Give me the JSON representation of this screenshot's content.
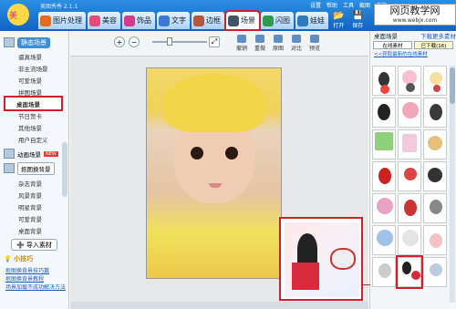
{
  "window": {
    "title": "美图秀秀 2.1.1"
  },
  "menu": [
    "设置",
    "帮助",
    "工具",
    "截图",
    "皮肤"
  ],
  "tabs": [
    {
      "label": "图片处理",
      "color": "#e46a1c",
      "active": false
    },
    {
      "label": "美容",
      "color": "#e44b7a",
      "active": false
    },
    {
      "label": "饰品",
      "color": "#d63a8a",
      "active": false
    },
    {
      "label": "文字",
      "color": "#3a7ad6",
      "active": false
    },
    {
      "label": "边框",
      "color": "#b7563a",
      "active": false
    },
    {
      "label": "场景",
      "color": "#445566",
      "active": true
    },
    {
      "label": "闪图",
      "color": "#2b9c4b",
      "active": false
    },
    {
      "label": "娃娃",
      "color": "#2a7bbf",
      "active": false
    }
  ],
  "right_toolbar": [
    {
      "glyph": "📂",
      "label": "打开"
    },
    {
      "glyph": "💾",
      "label": "保存"
    }
  ],
  "watermark": {
    "line1": "网页教学网",
    "line2": "www.webjx.com"
  },
  "left_panel": {
    "section1_label": "静态场景",
    "section1_items": [
      "逼真场景",
      "非主流场景",
      "可爱场景",
      "拼图场景",
      "桌面场景",
      "节日贺卡",
      "其他场景",
      "用户自定义"
    ],
    "selected_item": "桌面场景",
    "section2_label": "动画场景",
    "section2_badge": "NEW",
    "section3_label": "抠图换背景",
    "section3_items": [
      "杂志背景",
      "风景背景",
      "明星背景",
      "可爱背景",
      "桌面背景"
    ],
    "import_label": "导入素材",
    "tips_title": "小技巧",
    "tips_links": [
      "抠图换背景技巧篇",
      "抠图换背景教程",
      "场景加载不成功解决方法"
    ]
  },
  "toolbar": {
    "zoom_in": "+",
    "zoom_out": "−",
    "tools": [
      "撤销",
      "重做",
      "原图",
      "对比",
      "预览"
    ]
  },
  "right_panel": {
    "title": "桌面场景",
    "download_label": "下载更多素材",
    "tab_online": "在线素材",
    "tab_downloaded": "已下载(16)",
    "recent_link": "<<获取最新的在线素材"
  },
  "colors": {
    "accent": "#1063c4",
    "highlight": "#d0202a"
  }
}
